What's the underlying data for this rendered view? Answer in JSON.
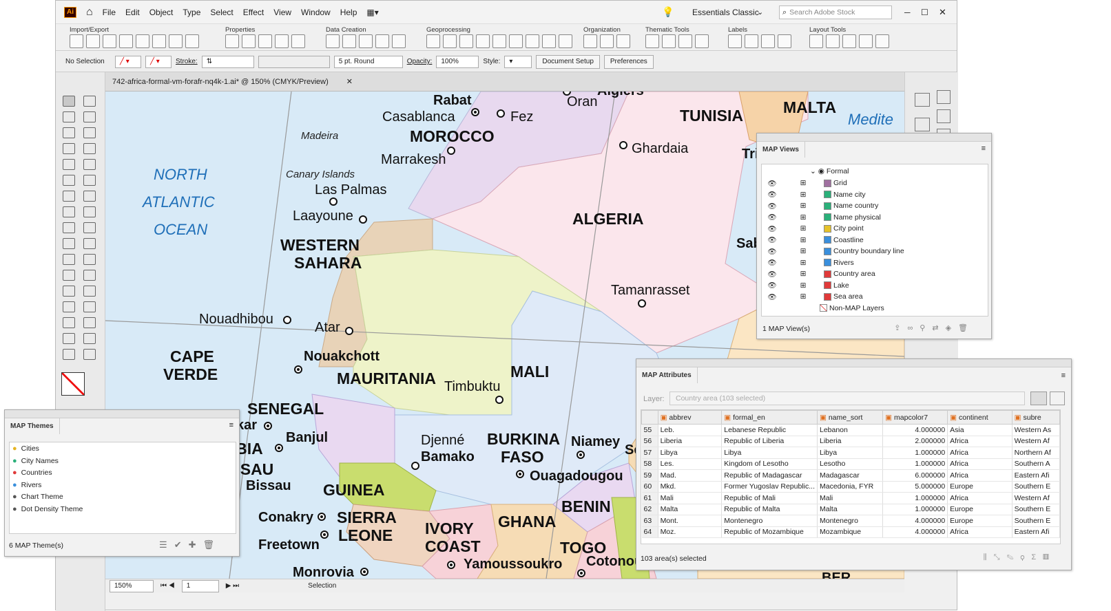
{
  "app": {
    "logo": "Ai",
    "title": "742-africa-formal-vm-forafr-nq4k-1.ai* @ 150% (CMYK/Preview)"
  },
  "menu": [
    "File",
    "Edit",
    "Object",
    "Type",
    "Select",
    "Effect",
    "View",
    "Window",
    "Help"
  ],
  "workspace": "Essentials Classic",
  "search_placeholder": "Search Adobe Stock",
  "ribbon_groups": [
    "Import/Export",
    "Properties",
    "Data Creation",
    "Geoprocessing",
    "Organization",
    "Thematic Tools",
    "Labels",
    "Layout Tools"
  ],
  "control": {
    "selection": "No Selection",
    "stroke_label": "Stroke:",
    "brush": "5 pt. Round",
    "opacity_label": "Opacity:",
    "opacity": "100%",
    "style_label": "Style:",
    "doc_setup": "Document Setup",
    "preferences": "Preferences"
  },
  "status": {
    "zoom": "150%",
    "page": "1",
    "tool": "Selection"
  },
  "map": {
    "oceans": [
      "NORTH",
      "ATLANTIC",
      "OCEAN"
    ],
    "islands": [
      "Madeira",
      "Canary Islands"
    ],
    "sea": "Medite",
    "countries": [
      "MOROCCO",
      "TUNISIA",
      "MALTA",
      "ALGERIA",
      "WESTERN",
      "SAHARA",
      "MAURITANIA",
      "MALI",
      "CAPE",
      "VERDE",
      "SENEGAL",
      "MBIA",
      "ISSAU",
      "GUINEA",
      "SIERRA",
      "LEONE",
      "IVORY",
      "COAST",
      "BURKINA",
      "FASO",
      "GHANA",
      "BENIN",
      "TOGO"
    ],
    "cities": [
      "Rabat",
      "Casablanca",
      "Fez",
      "Algiers",
      "Oran",
      "Marrakesh",
      "Ghardaia",
      "Las Palmas",
      "Laayoune",
      "Tamanrasset",
      "Nouadhibou",
      "Atar",
      "Nouakchott",
      "Timbuktu",
      "kar",
      "Banjul",
      "Bissau",
      "Conakry",
      "Freetown",
      "Monrovia",
      "Djenné",
      "Bamako",
      "Niamey",
      "Ouagadougou",
      "Yamoussoukro",
      "Cotonou",
      "Tri",
      "Sab",
      "Sc",
      "BER"
    ]
  },
  "map_views": {
    "title": "MAP Views",
    "root": "Formal",
    "layers": [
      {
        "name": "Grid",
        "color": "#a070a0"
      },
      {
        "name": "Name city",
        "color": "#2bb07a"
      },
      {
        "name": "Name country",
        "color": "#2bb07a"
      },
      {
        "name": "Name physical",
        "color": "#2bb07a"
      },
      {
        "name": "City point",
        "color": "#e6c22a"
      },
      {
        "name": "Coastline",
        "color": "#3a8fdc"
      },
      {
        "name": "Country boundary line",
        "color": "#3a8fdc"
      },
      {
        "name": "Rivers",
        "color": "#3a8fdc"
      },
      {
        "name": "Country area",
        "color": "#e03a3a"
      },
      {
        "name": "Lake",
        "color": "#e03a3a"
      },
      {
        "name": "Sea area",
        "color": "#e03a3a"
      }
    ],
    "non_map": "Non-MAP Layers",
    "footer": "1 MAP View(s)"
  },
  "map_themes": {
    "title": "MAP Themes",
    "items": [
      {
        "name": "Cities",
        "color": "#e6b422"
      },
      {
        "name": "City Names",
        "color": "#2bb07a"
      },
      {
        "name": "Countries",
        "color": "#e03a3a"
      },
      {
        "name": "Rivers",
        "color": "#3a8fdc"
      },
      {
        "name": "Chart Theme",
        "color": "#555"
      },
      {
        "name": "Dot Density Theme",
        "color": "#555"
      }
    ],
    "footer": "6 MAP Theme(s)"
  },
  "map_attributes": {
    "title": "MAP Attributes",
    "layer_label": "Layer:",
    "layer_value": "Country area (103 selected)",
    "columns": [
      "abbrev",
      "formal_en",
      "name_sort",
      "mapcolor7",
      "continent",
      "subre"
    ],
    "rows": [
      [
        "55",
        "Leb.",
        "Lebanese Republic",
        "Lebanon",
        "4.000000",
        "Asia",
        "Western As"
      ],
      [
        "56",
        "Liberia",
        "Republic of Liberia",
        "Liberia",
        "2.000000",
        "Africa",
        "Western Af"
      ],
      [
        "57",
        "Libya",
        "Libya",
        "Libya",
        "1.000000",
        "Africa",
        "Northern Af"
      ],
      [
        "58",
        "Les.",
        "Kingdom of Lesotho",
        "Lesotho",
        "1.000000",
        "Africa",
        "Southern A"
      ],
      [
        "59",
        "Mad.",
        "Republic of Madagascar",
        "Madagascar",
        "6.000000",
        "Africa",
        "Eastern Afi"
      ],
      [
        "60",
        "Mkd.",
        "Former Yugoslav Republic...",
        "Macedonia, FYR",
        "5.000000",
        "Europe",
        "Southern E"
      ],
      [
        "61",
        "Mali",
        "Republic of Mali",
        "Mali",
        "1.000000",
        "Africa",
        "Western Af"
      ],
      [
        "62",
        "Malta",
        "Republic of Malta",
        "Malta",
        "1.000000",
        "Europe",
        "Southern E"
      ],
      [
        "63",
        "Mont.",
        "Montenegro",
        "Montenegro",
        "4.000000",
        "Europe",
        "Southern E"
      ],
      [
        "64",
        "Moz.",
        "Republic of Mozambique",
        "Mozambique",
        "4.000000",
        "Africa",
        "Eastern Afi"
      ]
    ],
    "footer": "103 area(s) selected"
  }
}
